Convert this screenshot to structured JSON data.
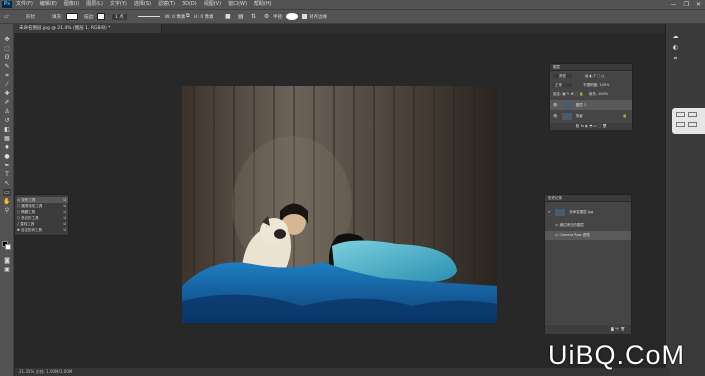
{
  "app": {
    "logo": "Ps"
  },
  "menubar": {
    "items": [
      "文件(F)",
      "编辑(E)",
      "图像(I)",
      "图层(L)",
      "文字(Y)",
      "选择(S)",
      "滤镜(T)",
      "3D(D)",
      "视图(V)",
      "窗口(W)",
      "帮助(H)"
    ]
  },
  "window_controls": {
    "minimize": "—",
    "restore": "❐",
    "close": "✕"
  },
  "options": {
    "shape_mode": "形状",
    "fill_label": "填充:",
    "stroke_label": "描边:",
    "stroke_width": "1 点",
    "w_value": "W: 0 像素",
    "h_value": "H: 0 像素",
    "radius_label": "半径:",
    "align_edges": "对齐边缘"
  },
  "document": {
    "tab_title": "未命名图层.jpg @ 21.4% (图层 1, RGB/8) *"
  },
  "tool_flyout": {
    "items": [
      {
        "label": "矩形工具",
        "key": "U",
        "selected": true
      },
      {
        "label": "圆角矩形工具",
        "key": "U",
        "selected": false
      },
      {
        "label": "椭圆工具",
        "key": "U",
        "selected": false
      },
      {
        "label": "多边形工具",
        "key": "U",
        "selected": false
      },
      {
        "label": "直线工具",
        "key": "U",
        "selected": false
      },
      {
        "label": "自定形状工具",
        "key": "U",
        "selected": false
      }
    ]
  },
  "layers": {
    "title": "图层",
    "filter": "类型",
    "blend": "正常",
    "opacity_label": "不透明度:",
    "opacity": "100%",
    "lock_label": "锁定:",
    "fill_label": "填充:",
    "fill": "100%",
    "rows": [
      {
        "name": "图层 1",
        "selected": true
      },
      {
        "name": "背景",
        "selected": false
      }
    ]
  },
  "history": {
    "title": "历史记录",
    "snapshot": "未命名图层.jpg",
    "items": [
      {
        "name": "通过拷贝的图层",
        "selected": false
      },
      {
        "name": "Camera Raw 滤镜",
        "selected": true
      }
    ]
  },
  "status": {
    "text": "21.35%    文档: 1.00M/1.00M"
  },
  "watermark": {
    "text": "UiBQ.CoM"
  },
  "colors": {
    "chrome": "#535353",
    "canvas": "#282828",
    "selection_blue": "#31a8ff"
  }
}
